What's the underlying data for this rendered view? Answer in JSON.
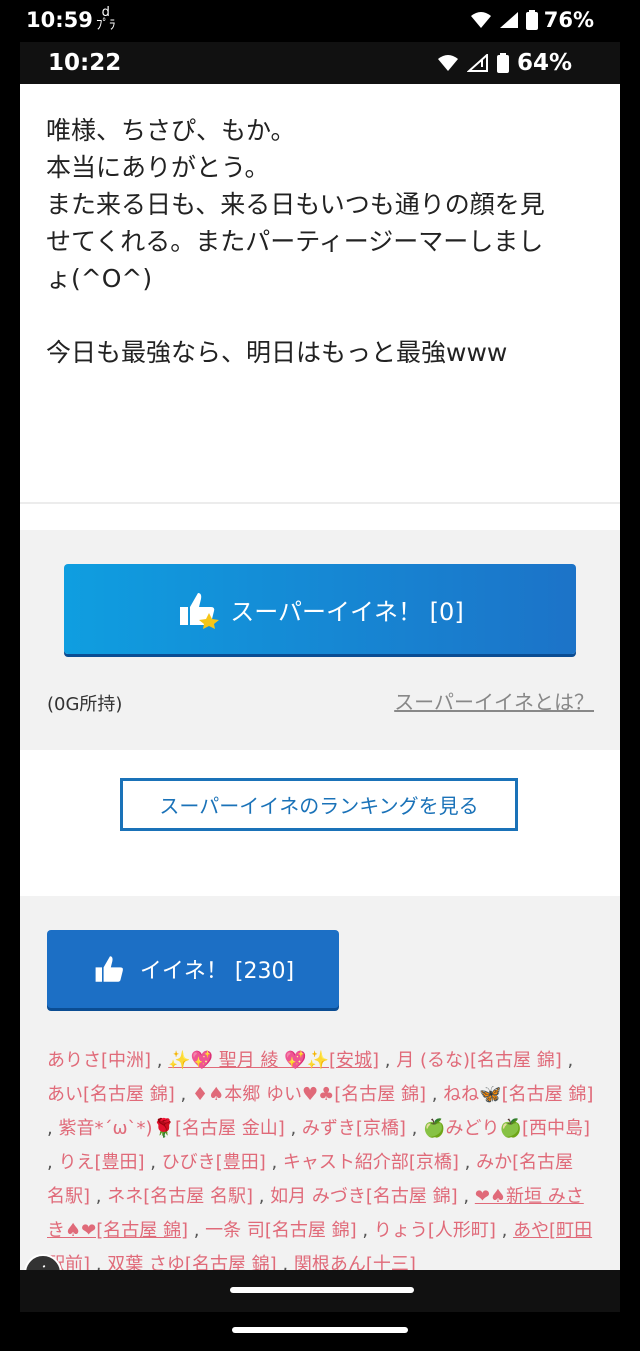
{
  "outer_status": {
    "time": "10:59",
    "battery": "76%"
  },
  "inner_status": {
    "time": "10:22",
    "battery": "64%"
  },
  "message": {
    "lines": [
      "唯様、ちさぴ、もか。",
      "本当にありがとう。",
      "また来る日も、来る日もいつも通りの顔を見",
      "せてくれる。またパーティージーマーしまし",
      "ょ(^O^)",
      "今日も最強なら、明日はもっと最強www"
    ]
  },
  "super_like": {
    "button_label": "スーパーイイネ！ [0]",
    "owned": "(0G所持)",
    "what_link": "スーパーイイネとは？"
  },
  "ranking": {
    "button_label": "スーパーイイネのランキングを見る"
  },
  "like": {
    "button_label": "イイネ！ [230]"
  },
  "likers": [
    "ありさ[中洲]",
    "✨💖 聖月 綾 💖✨[安城]",
    "月 (るな)[名古屋 錦]",
    "あい[名古屋 錦]",
    "♦♠本郷 ゆい♥♣[名古屋 錦]",
    "ねね🦋[名古屋 錦]",
    "紫音*´ω`*)🌹[名古屋 金山]",
    "みずき[京橋]",
    "🍏みどり🍏[西中島]",
    "りえ[豊田]",
    "ひびき[豊田]",
    "キャスト紹介部[京橋]",
    "みか[名古屋 名駅]",
    "ネネ[名古屋 名駅]",
    "如月 みづき[名古屋 錦]",
    "❤♠新垣 みさき♠❤[名古屋 錦]",
    "一条 司[名古屋 錦]",
    "りょう[人形町]",
    "あや[町田駅前]",
    "双葉 さゆ[名古屋 錦]",
    "関根あん[十三]"
  ],
  "colors": {
    "accent_blue": "#1c6fc5",
    "liker_pink": "#e06a79"
  }
}
